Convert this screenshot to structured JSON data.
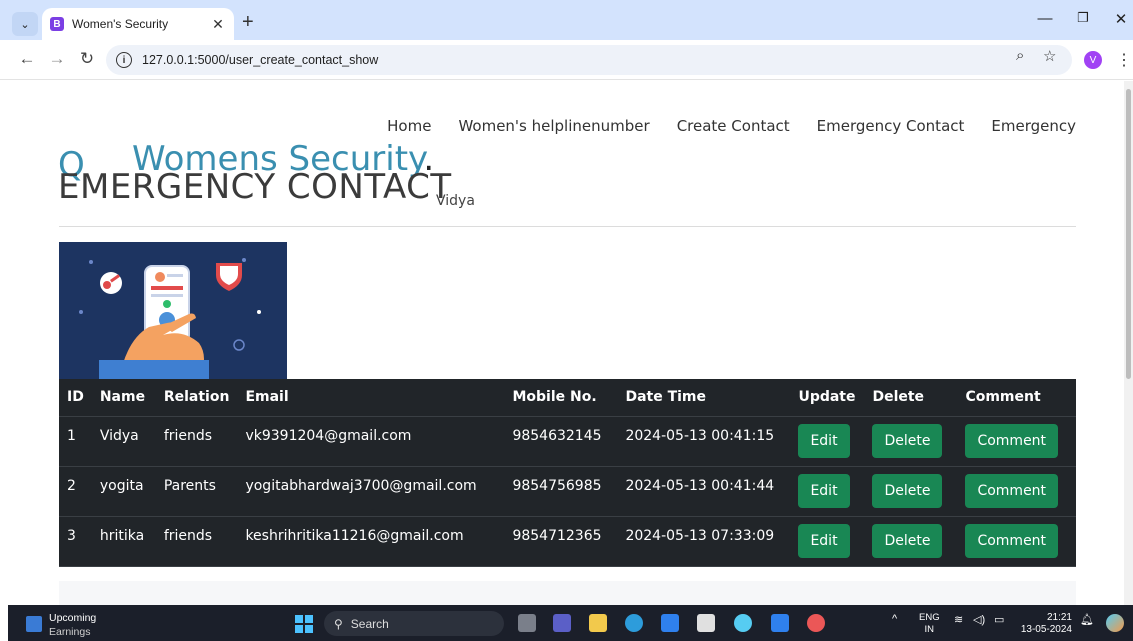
{
  "browser": {
    "tab_title": "Women's Security",
    "tab_favicon_letter": "B",
    "url": "127.0.0.1:5000/user_create_contact_show",
    "profile_initial": "V",
    "new_tab_symbol": "+",
    "close_symbol": "✕"
  },
  "site": {
    "logo_letter": "Q",
    "brand": "Womens Security",
    "brand_dot": ".",
    "nav": [
      "Home",
      "Women's helplinenumber",
      "Create Contact",
      "Emergency Contact",
      "Emergency"
    ],
    "page_title": "EMERGENCY CONTACT",
    "user_name": "Vidya"
  },
  "table": {
    "headers": [
      "ID",
      "Name",
      "Relation",
      "Email",
      "Mobile No.",
      "Date Time",
      "Update",
      "Delete",
      "Comment"
    ],
    "rows": [
      {
        "id": "1",
        "name": "Vidya",
        "relation": "friends",
        "email": "vk9391204@gmail.com",
        "mobile": "9854632145",
        "datetime": "2024-05-13 00:41:15"
      },
      {
        "id": "2",
        "name": "yogita",
        "relation": "Parents",
        "email": "yogitabhardwaj3700@gmail.com",
        "mobile": "9854756985",
        "datetime": "2024-05-13 00:41:44"
      },
      {
        "id": "3",
        "name": "hritika",
        "relation": "friends",
        "email": "keshrihritika11216@gmail.com",
        "mobile": "9854712365",
        "datetime": "2024-05-13 07:33:09"
      }
    ],
    "edit_label": "Edit",
    "delete_label": "Delete",
    "comment_label": "Comment"
  },
  "taskbar": {
    "weather_title": "Upcoming",
    "weather_subtitle": "Earnings",
    "search_placeholder": "Search",
    "lang_line1": "ENG",
    "lang_line2": "IN",
    "time": "21:21",
    "date": "13-05-2024"
  },
  "colors": {
    "brand": "#3a8fb0",
    "button": "#198754",
    "table_bg": "#212529",
    "tabbar": "#d3e3fd"
  }
}
